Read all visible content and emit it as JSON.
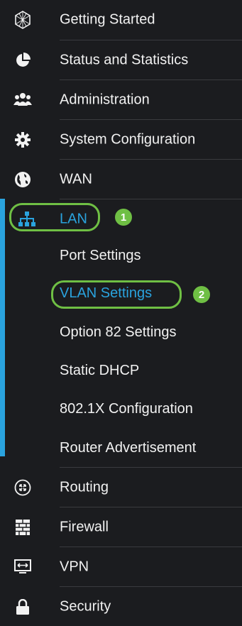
{
  "colors": {
    "background": "#1b1c1f",
    "text": "#f2f2f2",
    "accent": "#2aa3de",
    "callout": "#6fbf44",
    "divider": "#3a3b3f"
  },
  "menu": {
    "getting_started": {
      "label": "Getting Started",
      "icon": "globe-mesh-icon"
    },
    "status": {
      "label": "Status and Statistics",
      "icon": "pie-chart-icon"
    },
    "administration": {
      "label": "Administration",
      "icon": "users-icon"
    },
    "system": {
      "label": "System Configuration",
      "icon": "gear-icon"
    },
    "wan": {
      "label": "WAN",
      "icon": "globe-icon"
    },
    "lan": {
      "label": "LAN",
      "icon": "network-tree-icon",
      "badge": "1"
    },
    "lan_sub": {
      "port_settings": "Port Settings",
      "vlan_settings": "VLAN Settings",
      "vlan_badge": "2",
      "option82": "Option 82 Settings",
      "static_dhcp": "Static DHCP",
      "dot1x": "802.1X Configuration",
      "router_adv": "Router Advertisement"
    },
    "routing": {
      "label": "Routing",
      "icon": "routing-arrows-icon"
    },
    "firewall": {
      "label": "Firewall",
      "icon": "brick-wall-icon"
    },
    "vpn": {
      "label": "VPN",
      "icon": "monitor-arrows-icon"
    },
    "security": {
      "label": "Security",
      "icon": "lock-icon"
    }
  }
}
